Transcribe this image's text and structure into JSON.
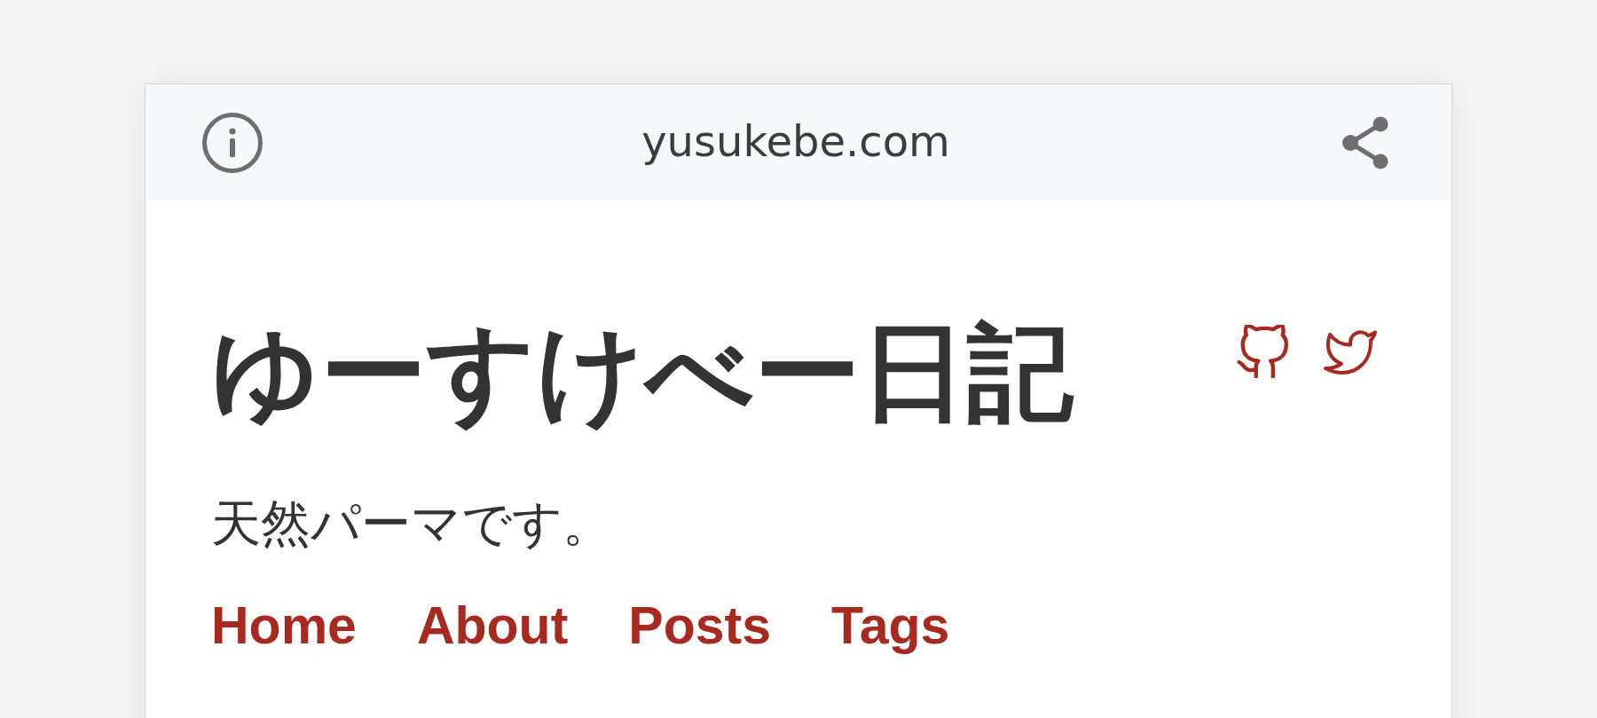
{
  "browser_bar": {
    "domain": "yusukebe.com"
  },
  "site": {
    "title": "ゆーすけべー日記",
    "tagline": "天然パーマです。"
  },
  "nav": [
    "Home",
    "About",
    "Posts",
    "Tags"
  ]
}
